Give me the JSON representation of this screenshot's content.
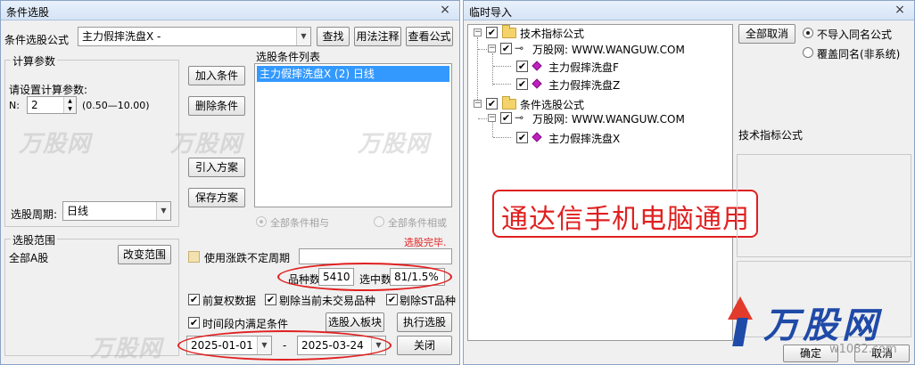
{
  "left_window": {
    "title": "条件选股",
    "close_glyph": "×",
    "formula_label": "条件选股公式",
    "formula_value": "主力假摔洗盘X  -",
    "btn_find": "查找",
    "btn_usage": "用法注释",
    "btn_view": "查看公式",
    "calc_group_title": "计算参数",
    "calc_prompt": "请设置计算参数:",
    "param_name": "N:",
    "param_value": "2",
    "param_range": "(0.50—10.00)",
    "period_label": "选股周期:",
    "period_value": "日线",
    "condition_list_title": "选股条件列表",
    "conditions": [
      "主力假摔洗盘X (2) 日线"
    ],
    "btn_add": "加入条件",
    "btn_delete": "删除条件",
    "btn_import_plan": "引入方案",
    "btn_save_plan": "保存方案",
    "radio_and": "全部条件相与",
    "radio_or": "全部条件相或",
    "status_done": "选股完毕.",
    "range_group_title": "选股范围",
    "range_value": "全部A股",
    "btn_change_range": "改变范围",
    "use_volatile": "使用涨跌不定周期",
    "count_label": "品种数",
    "count_value": "5410",
    "selected_label": "选中数",
    "selected_value": "81/1.5%",
    "opt_pre_adjust": "前复权数据",
    "opt_remove_untraded": "剔除当前未交易品种",
    "opt_remove_st": "剔除ST品种",
    "opt_time_range": "时间段内满足条件",
    "btn_to_block": "选股入板块",
    "btn_execute": "执行选股",
    "date_start": "2025-01-01",
    "date_sep": "-",
    "date_end": "2025-03-24",
    "btn_close": "关闭"
  },
  "right_window": {
    "title": "临时导入",
    "close_glyph": "×",
    "tree": {
      "root1": "技术指标公式",
      "root1_child": "万股网: WWW.WANGUW.COM",
      "root1_leaf1": "主力假摔洗盘F",
      "root1_leaf2": "主力假摔洗盘Z",
      "root2": "条件选股公式",
      "root2_child": "万股网: WWW.WANGUW.COM",
      "root2_leaf1": "主力假摔洗盘X"
    },
    "btn_cancel_all": "全部取消",
    "radio_no_import": "不导入同名公式",
    "radio_overwrite": "覆盖同名(非系统)",
    "info_label": "技术指标公式",
    "btn_ok": "确定",
    "btn_cancel": "取消"
  },
  "overlay": {
    "promo_text": "通达信手机电脑通用",
    "logo_text": "万股网",
    "logo_url_partial": "w1082.com",
    "watermark": "万股网"
  },
  "colors": {
    "selection_blue": "#3399ff",
    "red_annotation": "#e02020",
    "logo_blue": "#1f4aa8",
    "logo_red": "#e23b2b"
  }
}
